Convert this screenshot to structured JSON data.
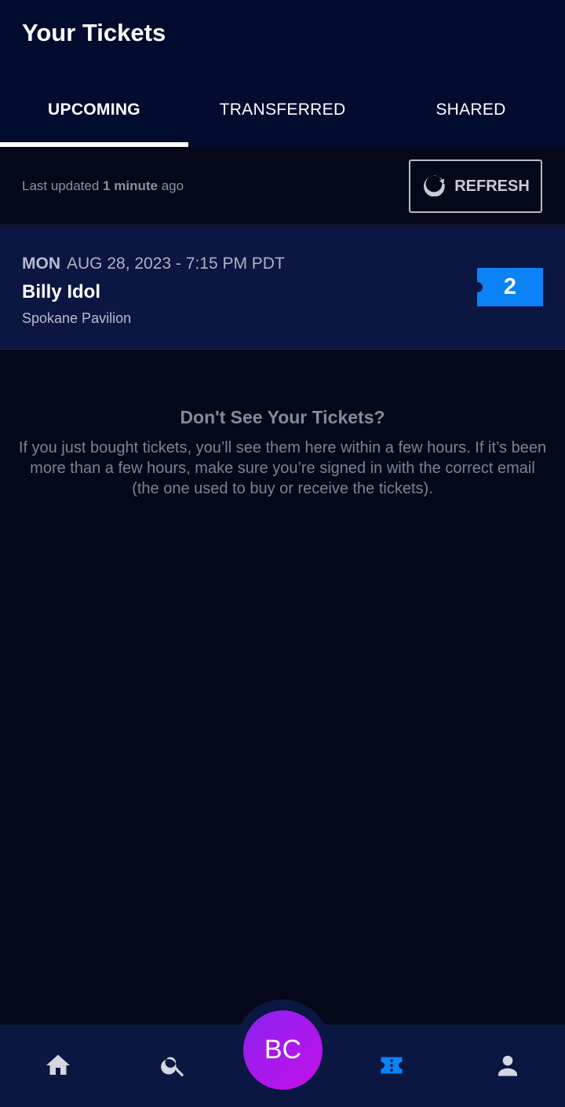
{
  "header": {
    "title": "Your Tickets",
    "tabs": [
      {
        "label": "UPCOMING",
        "active": true
      },
      {
        "label": "TRANSFERRED",
        "active": false
      },
      {
        "label": "SHARED",
        "active": false
      }
    ]
  },
  "status": {
    "prefix": "Last updated",
    "emphasis": "1 minute",
    "suffix": "ago",
    "refresh_label": "REFRESH",
    "refresh_icon": "refresh-icon"
  },
  "events": [
    {
      "day_of_week": "MON",
      "date_time": "AUG 28, 2023 - 7:15 PM PDT",
      "name": "Billy Idol",
      "venue": "Spokane Pavilion",
      "ticket_count": "2"
    }
  ],
  "info": {
    "title": "Don't See Your Tickets?",
    "body": "If you just bought tickets, you’ll see them here within a few hours. If it’s been more than a few hours, make sure you’re signed in with the correct email (the one used to buy or receive the tickets)."
  },
  "bottom_nav": {
    "items": [
      {
        "icon": "home-icon"
      },
      {
        "icon": "search-icon"
      },
      {
        "icon": "tickets-icon",
        "active": true
      },
      {
        "icon": "profile-icon"
      }
    ],
    "avatar_initials": "BC"
  },
  "colors": {
    "accent": "#0b82f5",
    "header_bg": "#020c2f",
    "card_bg": "#0b1642",
    "avatar_gradient_start": "#8b22f0",
    "avatar_gradient_end": "#c310e8"
  }
}
